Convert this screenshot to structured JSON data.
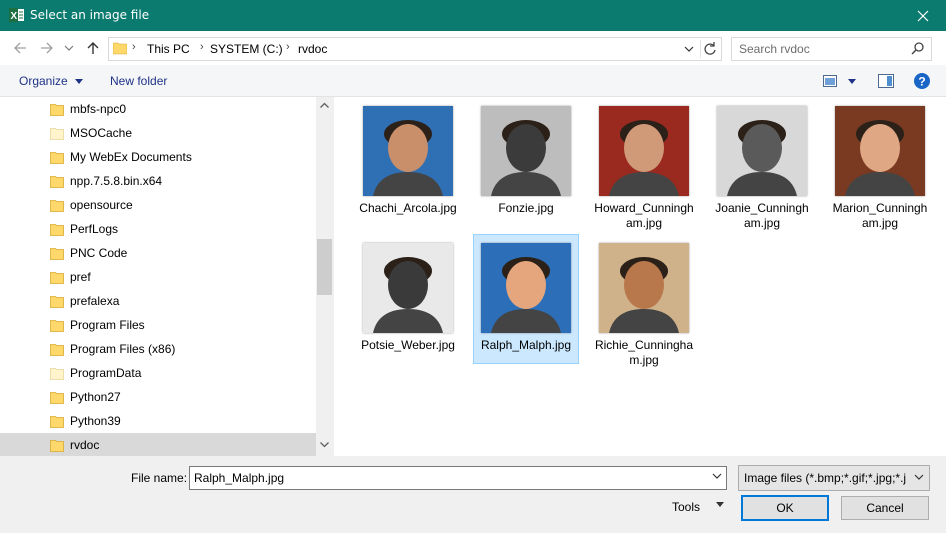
{
  "window": {
    "title": "Select an image file",
    "close_icon": "close-icon",
    "app_icon": "excel-icon"
  },
  "nav": {
    "back_icon": "back-arrow-icon",
    "forward_icon": "forward-arrow-icon",
    "recent_icon": "chevron-down-icon",
    "up_icon": "up-arrow-icon",
    "breadcrumb": [
      "This PC",
      "SYSTEM (C:)",
      "rvdoc"
    ],
    "search_placeholder": "Search rvdoc"
  },
  "commandbar": {
    "organize": "Organize",
    "new_folder": "New folder"
  },
  "sidebar": {
    "items": [
      {
        "label": "mbfs-npc0",
        "faded": false,
        "selected": false
      },
      {
        "label": "MSOCache",
        "faded": true,
        "selected": false
      },
      {
        "label": "My WebEx Documents",
        "faded": false,
        "selected": false
      },
      {
        "label": "npp.7.5.8.bin.x64",
        "faded": false,
        "selected": false
      },
      {
        "label": "opensource",
        "faded": false,
        "selected": false
      },
      {
        "label": "PerfLogs",
        "faded": false,
        "selected": false
      },
      {
        "label": "PNC Code",
        "faded": false,
        "selected": false
      },
      {
        "label": "pref",
        "faded": false,
        "selected": false
      },
      {
        "label": "prefalexa",
        "faded": false,
        "selected": false
      },
      {
        "label": "Program Files",
        "faded": false,
        "selected": false
      },
      {
        "label": "Program Files (x86)",
        "faded": false,
        "selected": false
      },
      {
        "label": "ProgramData",
        "faded": true,
        "selected": false
      },
      {
        "label": "Python27",
        "faded": false,
        "selected": false
      },
      {
        "label": "Python39",
        "faded": false,
        "selected": false
      },
      {
        "label": "rvdoc",
        "faded": false,
        "selected": true
      }
    ]
  },
  "files": [
    {
      "name": "Chachi_Arcola.jpg",
      "selected": false,
      "bg": "#2f6fb3",
      "fg": "#c98f6b"
    },
    {
      "name": "Fonzie.jpg",
      "selected": false,
      "bg": "#bdbdbd",
      "fg": "#3b3b3b"
    },
    {
      "name": "Howard_Cunningham.jpg",
      "selected": false,
      "bg": "#9a2a1f",
      "fg": "#d09a78"
    },
    {
      "name": "Joanie_Cunningham.jpg",
      "selected": false,
      "bg": "#d8d8d8",
      "fg": "#5a5a5a"
    },
    {
      "name": "Marion_Cunningham.jpg",
      "selected": false,
      "bg": "#7a3a22",
      "fg": "#e0a784"
    },
    {
      "name": "Potsie_Weber.jpg",
      "selected": false,
      "bg": "#e9e9e9",
      "fg": "#3a3a3a"
    },
    {
      "name": "Ralph_Malph.jpg",
      "selected": true,
      "bg": "#2c6fb8",
      "fg": "#e5a67d"
    },
    {
      "name": "Richie_Cunningham.jpg",
      "selected": false,
      "bg": "#d0b28a",
      "fg": "#b9784c"
    }
  ],
  "footer": {
    "filename_label": "File name:",
    "filename_value": "Ralph_Malph.jpg",
    "filter_value": "Image files (*.bmp;*.gif;*.jpg;*.j",
    "tools_label": "Tools",
    "ok_label": "OK",
    "cancel_label": "Cancel"
  },
  "colors": {
    "titlebar": "#0b7a6f",
    "selection": "#cce8ff",
    "accent": "#0078d7",
    "folder": "#ffd86b"
  }
}
